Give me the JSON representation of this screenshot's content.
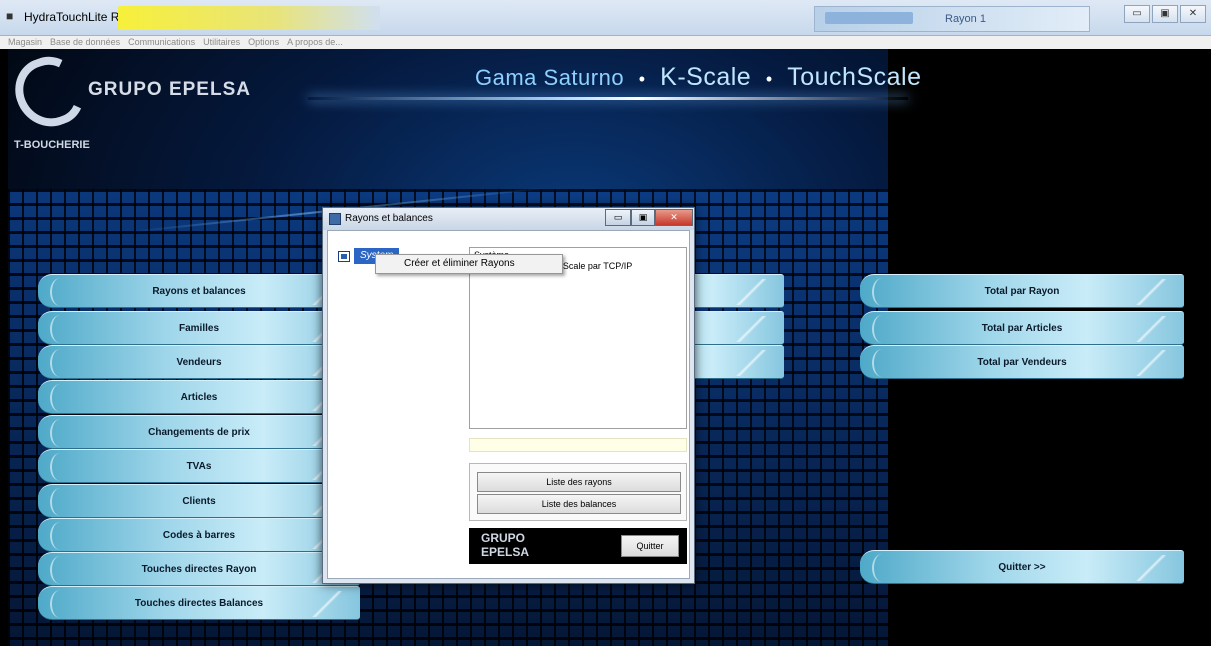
{
  "window": {
    "title": "HydraTouchLite Release 1.4.19",
    "right_field_text": "Rayon 1",
    "controls": {
      "minimize": "▭",
      "maximize": "▣",
      "close": "✕"
    }
  },
  "menubar": [
    "Magasin",
    "Base de données",
    "Communications",
    "Utilitaires",
    "Options",
    "A propos de..."
  ],
  "branding": {
    "company": "GRUPO EPELSA",
    "subtitle": "T-BOUCHERIE",
    "header_part1": "Gama Saturno",
    "header_part2": "K-Scale",
    "header_part3": "TouchScale",
    "separator": "•"
  },
  "left_menu": [
    "Rayons et balances",
    "Familles",
    "Vendeurs",
    "Articles",
    "Changements de prix",
    "TVAs",
    "Clients",
    "Codes à barres",
    "Touches directes Rayon",
    "Touches directes Balances"
  ],
  "right_menu": {
    "total_rayon": "Total par Rayon",
    "total_articles": "Total par Articles",
    "total_vendeurs": "Total par Vendeurs",
    "quit": "Quitter >>"
  },
  "dialog": {
    "title": "Rayons et balances",
    "tree_node": "System",
    "context_menu_item": "Créer et éliminer Rayons",
    "description_line1": "Système",
    "description_line2": "Communication TouchScale par TCP/IP",
    "buttons": {
      "list_rayons": "Liste des rayons",
      "list_balances": "Liste des balances",
      "quit": "Quitter"
    },
    "footer_logo_line1": "GRUPO",
    "footer_logo_line2": "EPELSA"
  },
  "colors": {
    "accent_blue": "#2b66c4",
    "button_cyan": "#9fd6ea",
    "header_blue": "#8fd0ff"
  }
}
